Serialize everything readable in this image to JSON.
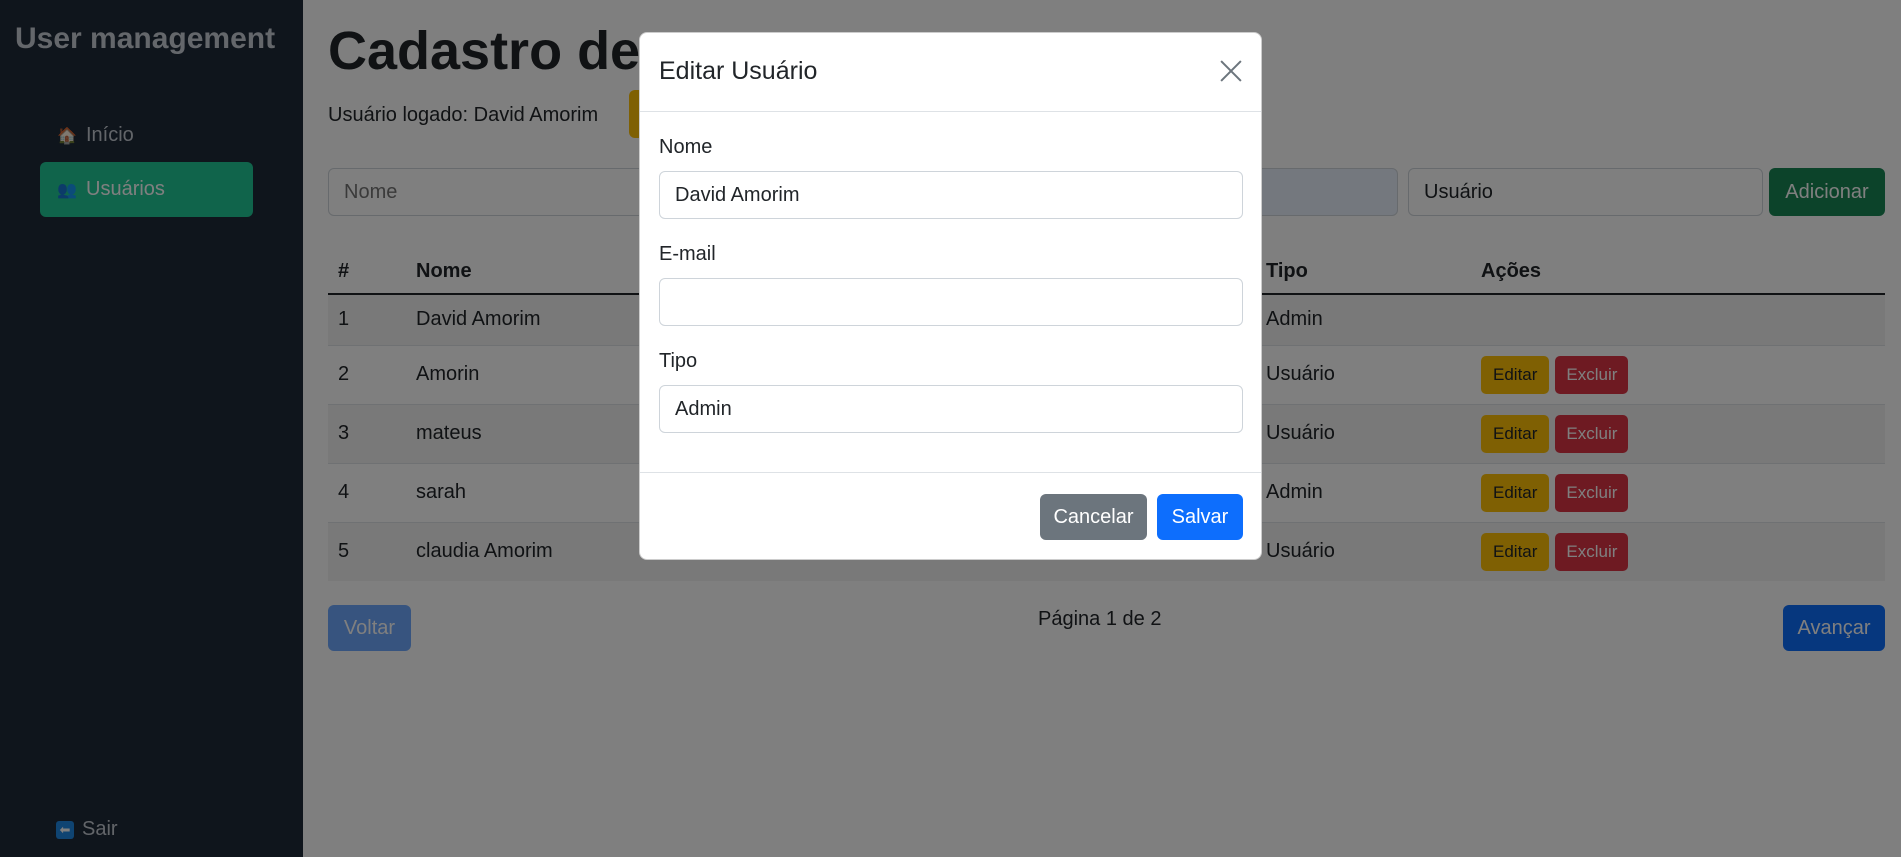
{
  "sidebar": {
    "brand": "User management",
    "items": [
      {
        "label": "Início",
        "icon": "house-icon"
      },
      {
        "label": "Usuários",
        "icon": "users-icon",
        "active": true
      }
    ],
    "logout": {
      "label": "Sair",
      "icon": "arrow-left-icon"
    }
  },
  "main": {
    "title": "Cadastro de U",
    "logged_user": "Usuário logado: David Amorim",
    "form": {
      "nome_placeholder": "Nome",
      "email_placeholder": "",
      "tipo_value": "Usuário",
      "add_label": "Adicionar"
    },
    "table": {
      "headers": [
        "#",
        "Nome",
        "Tipo",
        "Ações"
      ],
      "rows": [
        {
          "id": "1",
          "nome": "David Amorim",
          "tipo": "Admin",
          "actions": false
        },
        {
          "id": "2",
          "nome": "Amorin",
          "tipo": "Usuário",
          "actions": true
        },
        {
          "id": "3",
          "nome": "mateus",
          "tipo": "Usuário",
          "actions": true
        },
        {
          "id": "4",
          "nome": "sarah",
          "tipo": "Admin",
          "actions": true
        },
        {
          "id": "5",
          "nome": "claudia Amorim",
          "tipo": "Usuário",
          "actions": true
        }
      ],
      "edit_label": "Editar",
      "delete_label": "Excluir"
    },
    "pagination": {
      "prev_label": "Voltar",
      "status": "Página 1 de 2",
      "next_label": "Avançar"
    }
  },
  "modal": {
    "title": "Editar Usuário",
    "fields": {
      "nome": {
        "label": "Nome",
        "value": "David Amorim"
      },
      "email": {
        "label": "E-mail",
        "value": ""
      },
      "tipo": {
        "label": "Tipo",
        "value": "Admin"
      }
    },
    "cancel_label": "Cancelar",
    "save_label": "Salvar"
  },
  "colors": {
    "sidebar_bg": "#1f2a38",
    "active_item": "#20c997",
    "primary": "#0d6efd",
    "success": "#198754",
    "warning": "#ffc107",
    "danger": "#dc3545",
    "secondary": "#6c757d"
  }
}
